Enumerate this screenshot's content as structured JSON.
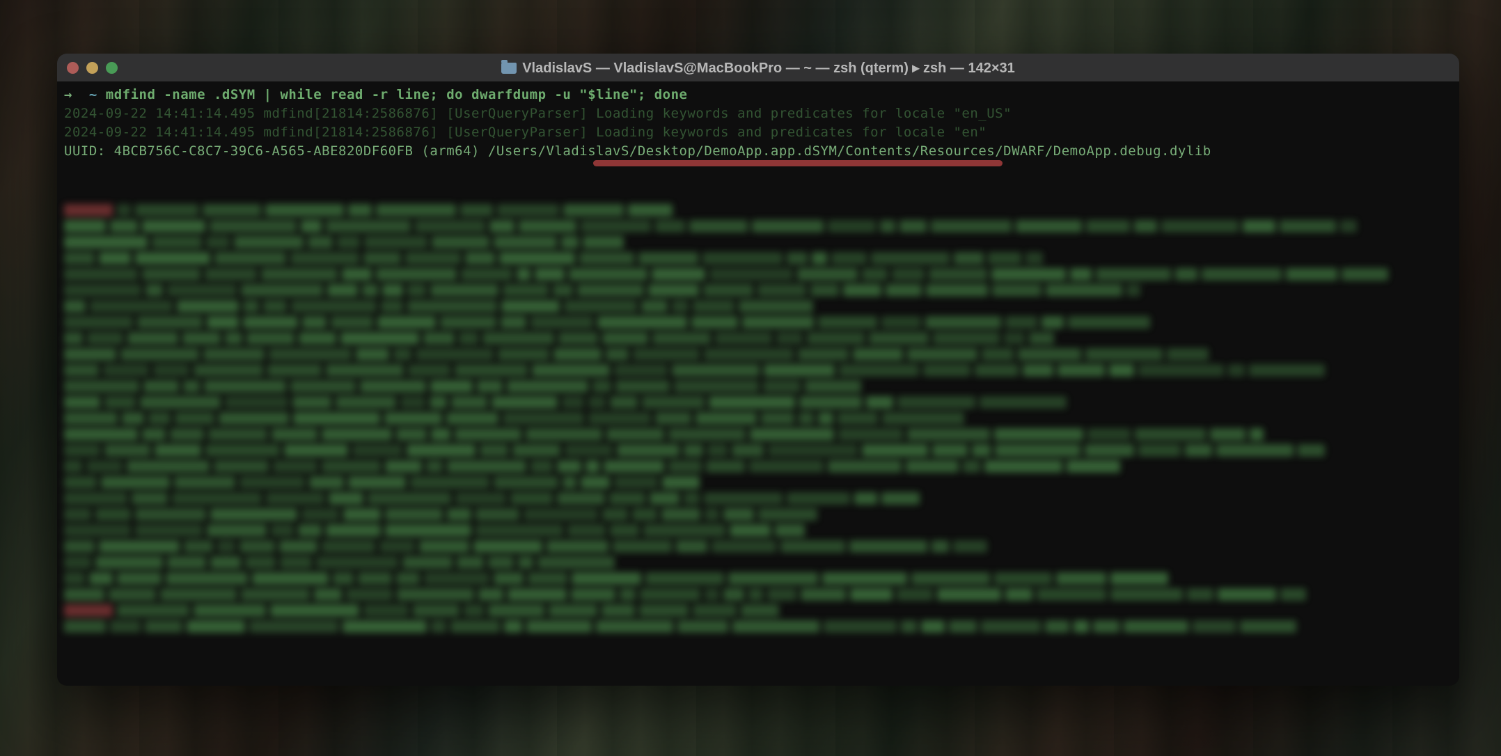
{
  "window": {
    "title": "VladislavS — VladislavS@MacBookPro — ~ — zsh (qterm) ▸ zsh — 142×31"
  },
  "prompt": {
    "arrow": "→",
    "path": "~",
    "command": "mdfind -name .dSYM | while read -r line; do dwarfdump -u \"$line\"; done"
  },
  "log": {
    "line1": "2024-09-22 14:41:14.495 mdfind[21814:2586876] [UserQueryParser] Loading keywords and predicates for locale \"en_US\"",
    "line2": "2024-09-22 14:41:14.495 mdfind[21814:2586876] [UserQueryParser] Loading keywords and predicates for locale \"en\""
  },
  "uuid": {
    "label": "UUID:",
    "value": "4BCB756C-C8C7-39C6-A565-ABE820DF60FB",
    "arch": "(arm64)",
    "path": "/Users/VladislavS/Desktop/DemoApp.app.dSYM/Contents/Resources/DWARF/DemoApp.debug.dylib"
  }
}
